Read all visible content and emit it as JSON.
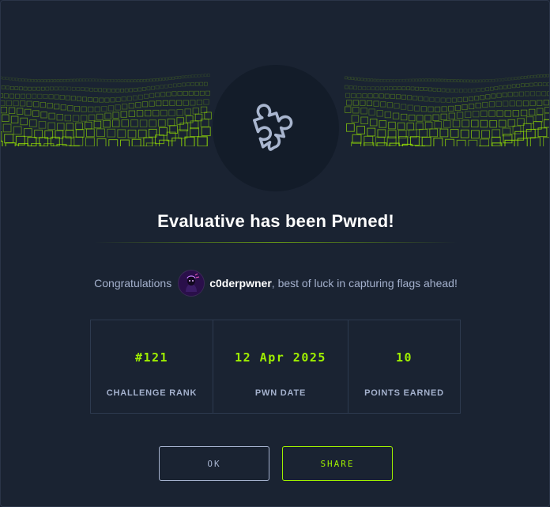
{
  "modal": {
    "title": "Evaluative has been Pwned!",
    "badge_icon": "puzzle-piece-icon",
    "accent_color": "#9fef00"
  },
  "congrats": {
    "prefix": "Congratulations",
    "username": "c0derpwner",
    "suffix": ", best of luck in capturing flags ahead!"
  },
  "stats": [
    {
      "value": "#121",
      "label": "CHALLENGE RANK"
    },
    {
      "value": "12 Apr 2025",
      "label": "PWN DATE"
    },
    {
      "value": "10",
      "label": "POINTS EARNED"
    }
  ],
  "buttons": {
    "ok_label": "OK",
    "share_label": "SHARE"
  }
}
